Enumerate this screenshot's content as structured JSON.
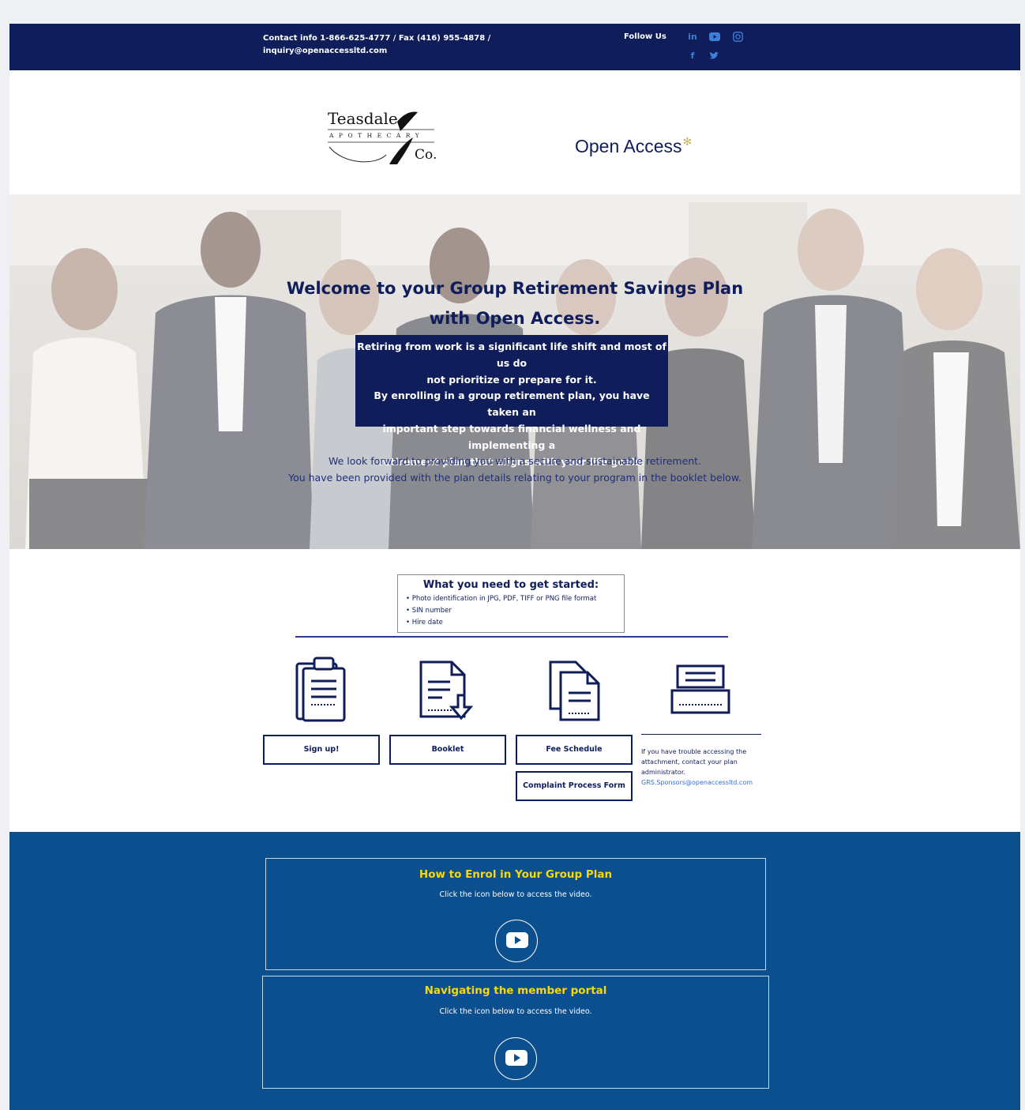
{
  "topbar": {
    "contact_line1": "Contact info 1-866-625-4777 / Fax (416) 955-4878 /",
    "contact_line2": "inquiry@openaccessltd.com",
    "follow_label": "Follow Us",
    "social_icons": [
      "linkedin-icon",
      "youtube-icon",
      "instagram-icon",
      "facebook-icon",
      "twitter-icon"
    ]
  },
  "logos": {
    "teasdale_line1": "Teasdale",
    "teasdale_line2": "APOTHECARY",
    "teasdale_line3": "Co.",
    "open_access": "Open Access"
  },
  "hero": {
    "title_line1": "Welcome to your Group Retirement Savings Plan",
    "title_line2": "with Open Access.",
    "box_line1": "Retiring from work is a significant life shift and most of us do",
    "box_line2": "not prioritize or prepare for it.",
    "box_line3": "By enrolling in a group retirement plan, you have taken an",
    "box_line4": "important step towards financial wellness and implementing a",
    "box_line5": "retirement plan that aligns with your life goals.",
    "foot_line1": "We look forward to providing you with a secure and sustainable retirement.",
    "foot_line2": "You have been provided with the plan details relating to your program in the booklet below."
  },
  "get_started": {
    "title": "What you need to get started:",
    "items": [
      "Photo identification in JPG, PDF, TIFF or PNG file format",
      "SIN number",
      "Hire date"
    ]
  },
  "actions": {
    "signup": "Sign up!",
    "booklet": "Booklet",
    "fee_schedule": "Fee Schedule",
    "complaint": "Complaint Process Form",
    "help_text": "If you have trouble accessing the attachment, contact your plan administrator.",
    "help_email": "GRS.Sponsors@openaccessltd.com"
  },
  "videos": [
    {
      "title": "How to Enrol in Your Group Plan",
      "subtitle": "Click the icon below to access the video."
    },
    {
      "title": "Navigating the member portal",
      "subtitle": "Click the icon below to access the video."
    }
  ],
  "colors": {
    "navy": "#0f1d5a",
    "video_bg": "#0c4f8f",
    "video_title": "#f5d90a",
    "link_blue": "#2f6fd6"
  }
}
